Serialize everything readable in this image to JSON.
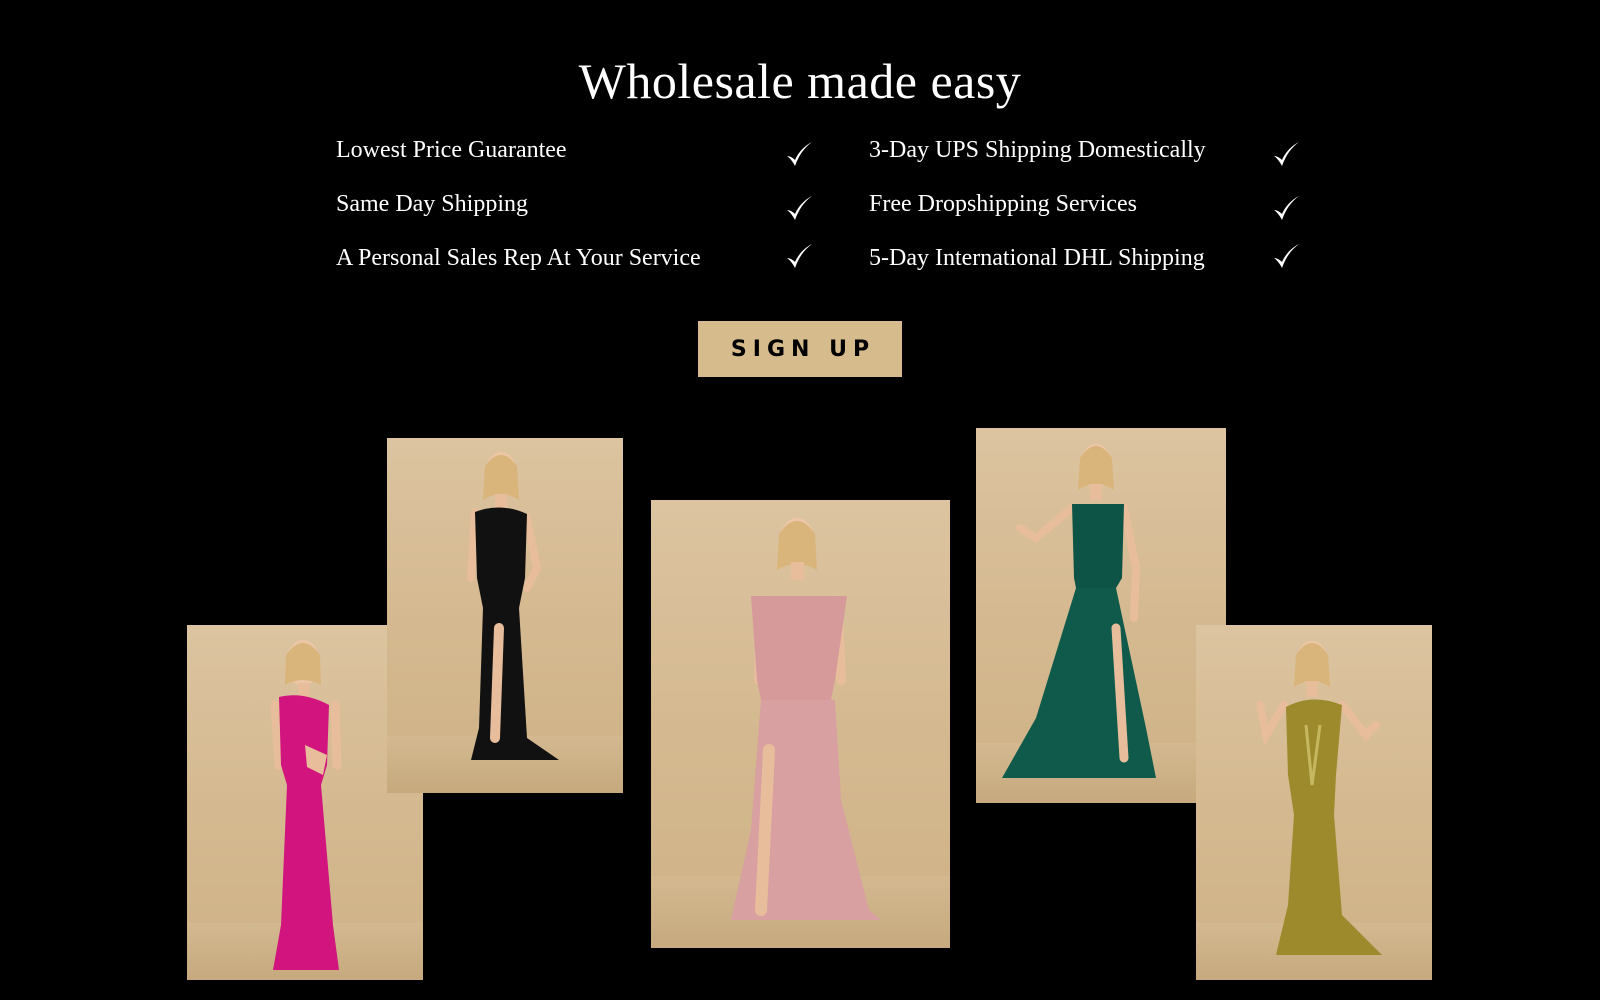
{
  "section": {
    "title": "Wholesale made easy"
  },
  "features": {
    "left": [
      {
        "label": "Lowest Price Guarantee",
        "icon": "checkmark-icon"
      },
      {
        "label": "Same Day Shipping",
        "icon": "checkmark-icon"
      },
      {
        "label": "A Personal Sales Rep At Your Service",
        "icon": "checkmark-icon"
      }
    ],
    "right": [
      {
        "label": "3-Day UPS Shipping Domestically",
        "icon": "checkmark-icon"
      },
      {
        "label": "Free Dropshipping Services",
        "icon": "checkmark-icon"
      },
      {
        "label": "5-Day International DHL Shipping",
        "icon": "checkmark-icon"
      }
    ]
  },
  "cta": {
    "label": "SIGN UP",
    "background": "#d6bb8c"
  },
  "gallery": {
    "background": "#d6bd96",
    "photos": [
      {
        "name": "magenta one-shoulder gown",
        "dress_color": "#d1147e"
      },
      {
        "name": "black lace gown",
        "dress_color": "#111111"
      },
      {
        "name": "blush satin off-shoulder gown",
        "dress_color": "#d79a9b"
      },
      {
        "name": "emerald chiffon gown",
        "dress_color": "#0e5446"
      },
      {
        "name": "gold metallic gown",
        "dress_color": "#9c8a2c"
      }
    ]
  }
}
